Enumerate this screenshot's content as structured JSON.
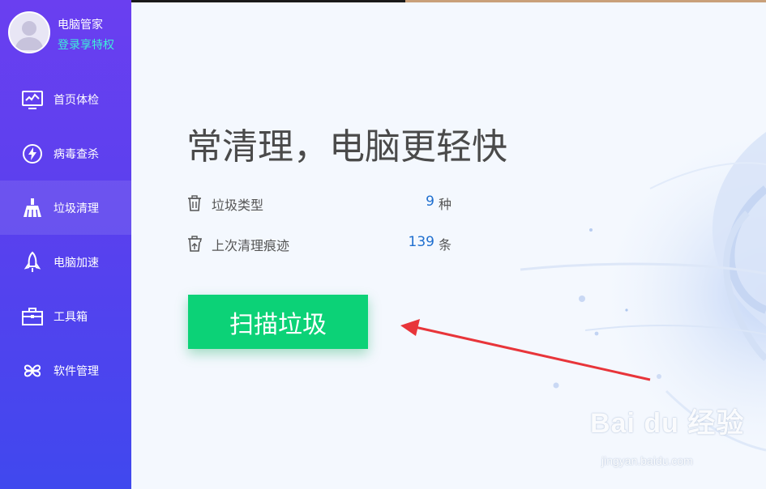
{
  "profile": {
    "name": "电脑管家",
    "login_link": "登录享特权"
  },
  "sidebar": {
    "items": [
      {
        "label": "首页体检",
        "icon": "monitor-icon",
        "active": false
      },
      {
        "label": "病毒查杀",
        "icon": "lightning-shield-icon",
        "active": false
      },
      {
        "label": "垃圾清理",
        "icon": "broom-icon",
        "active": true
      },
      {
        "label": "电脑加速",
        "icon": "rocket-icon",
        "active": false
      },
      {
        "label": "工具箱",
        "icon": "toolbox-icon",
        "active": false
      },
      {
        "label": "软件管理",
        "icon": "software-icon",
        "active": false
      }
    ]
  },
  "main": {
    "headline": "常清理，电脑更轻快",
    "stats": [
      {
        "label": "垃圾类型",
        "value": "9",
        "unit": "种",
        "icon": "trash-can-icon"
      },
      {
        "label": "上次清理痕迹",
        "value": "139",
        "unit": "条",
        "icon": "trash-history-icon"
      }
    ],
    "scan_button": "扫描垃圾"
  },
  "watermark": {
    "brand": "Bai du 经验",
    "url": "jingyan.baidu.com"
  },
  "colors": {
    "sidebar_top": "#6a3ff0",
    "sidebar_bottom": "#4048ee",
    "login_link": "#3ef0d8",
    "accent_green": "#0cd277",
    "value_blue": "#1f6fcf",
    "arrow_red": "#e8353a"
  }
}
